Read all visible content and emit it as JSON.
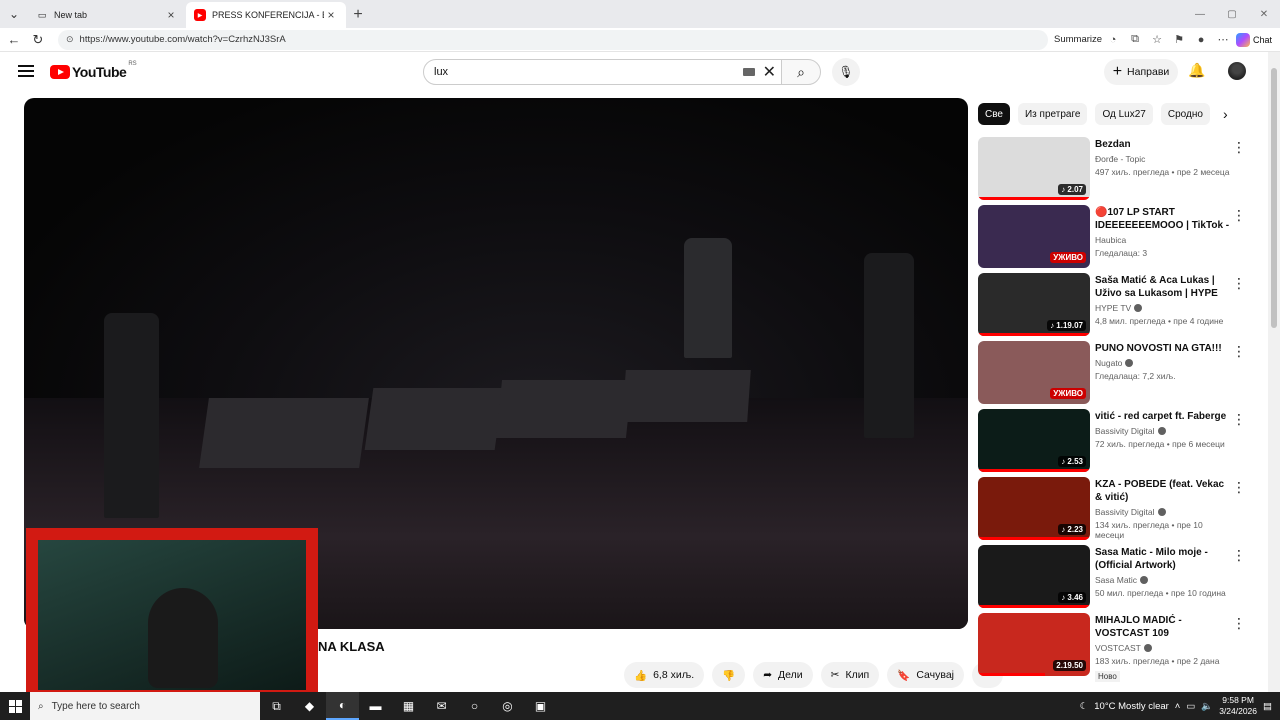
{
  "browser": {
    "tabs": [
      {
        "title": "New tab",
        "active": false
      },
      {
        "title": "PRESS KONFERENCIJA - BOX EVEN",
        "active": true
      }
    ],
    "url": "https://www.youtube.com/watch?v=CzrhzNJ3SrA",
    "summarize_label": "Summarize",
    "chat_label": "Chat"
  },
  "youtube": {
    "logo_text": "YouTube",
    "country_code": "RS",
    "search_value": "lux",
    "create_label": "Направи"
  },
  "video": {
    "title_visible": "NA KLASA",
    "likes": "6,8 хиљ.",
    "share_label": "Дели",
    "clip_label": "Клип",
    "save_label": "Сачувај"
  },
  "chips": [
    "Све",
    "Из претраге",
    "Од Lux27",
    "Сродно"
  ],
  "recommendations": [
    {
      "title": "Bezdan",
      "channel": "Đorđe - Topic",
      "verified": false,
      "stats": "497 хиљ. прегледа • пре 2 месеца",
      "duration": "2.07",
      "music": true,
      "live": false,
      "thumb": "#dcdcdc",
      "progress": 1.0
    },
    {
      "title": "🔴107 LP START IDEEEEEEEMOOO | TikTok - ...",
      "channel": "Haubica",
      "verified": false,
      "stats": "Гледалаца: 3",
      "duration": "УЖИВО",
      "music": false,
      "live": true,
      "thumb": "#3a2a50",
      "progress": 0
    },
    {
      "title": "Saša Matić & Aca Lukas | Uživo sa Lukasom | HYPE TV",
      "channel": "HYPE TV",
      "verified": true,
      "stats": "4,8 мил. прегледа • пре 4 године",
      "duration": "1.19.07",
      "music": true,
      "live": false,
      "thumb": "#2a2a2a",
      "progress": 1.0
    },
    {
      "title": "PUNO NOVOSTI NA GTA!!!",
      "channel": "Nugato",
      "verified": true,
      "stats": "Гледалаца: 7,2 хиљ.",
      "duration": "УЖИВО",
      "music": false,
      "live": true,
      "thumb": "#8a5a5a",
      "progress": 0
    },
    {
      "title": "vitić - red carpet ft. Faberge",
      "channel": "Bassivity Digital",
      "verified": true,
      "stats": "72 хиљ. прегледа • пре 6 месеци",
      "duration": "2.53",
      "music": true,
      "live": false,
      "thumb": "#0c1c18",
      "progress": 1.0
    },
    {
      "title": "KZA - POBEDE (feat. Vekac & vitić)",
      "channel": "Bassivity Digital",
      "verified": true,
      "stats": "134 хиљ. прегледа • пре 10 месеци",
      "duration": "2.23",
      "music": true,
      "live": false,
      "thumb": "#7a1a0c",
      "progress": 1.0
    },
    {
      "title": "Sasa Matic - Milo moje - (Official Artwork)",
      "channel": "Sasa Matic",
      "verified": true,
      "stats": "50 мил. прегледа • пре 10 година",
      "duration": "3.46",
      "music": true,
      "live": false,
      "thumb": "#1a1a1a",
      "progress": 1.0
    },
    {
      "title": "MIHAJLO MADIĆ - VOSTCAST 109",
      "channel": "VOSTCAST",
      "verified": true,
      "stats": "183 хиљ. прегледа • пре 2 дана",
      "duration": "2.19.50",
      "music": false,
      "live": false,
      "thumb": "#c8281e",
      "progress": 0.6,
      "badge": "Ново"
    }
  ],
  "taskbar": {
    "search_placeholder": "Type here to search",
    "weather": "10°C  Mostly clear",
    "time": "9:58 PM",
    "date": "3/24/2026"
  }
}
